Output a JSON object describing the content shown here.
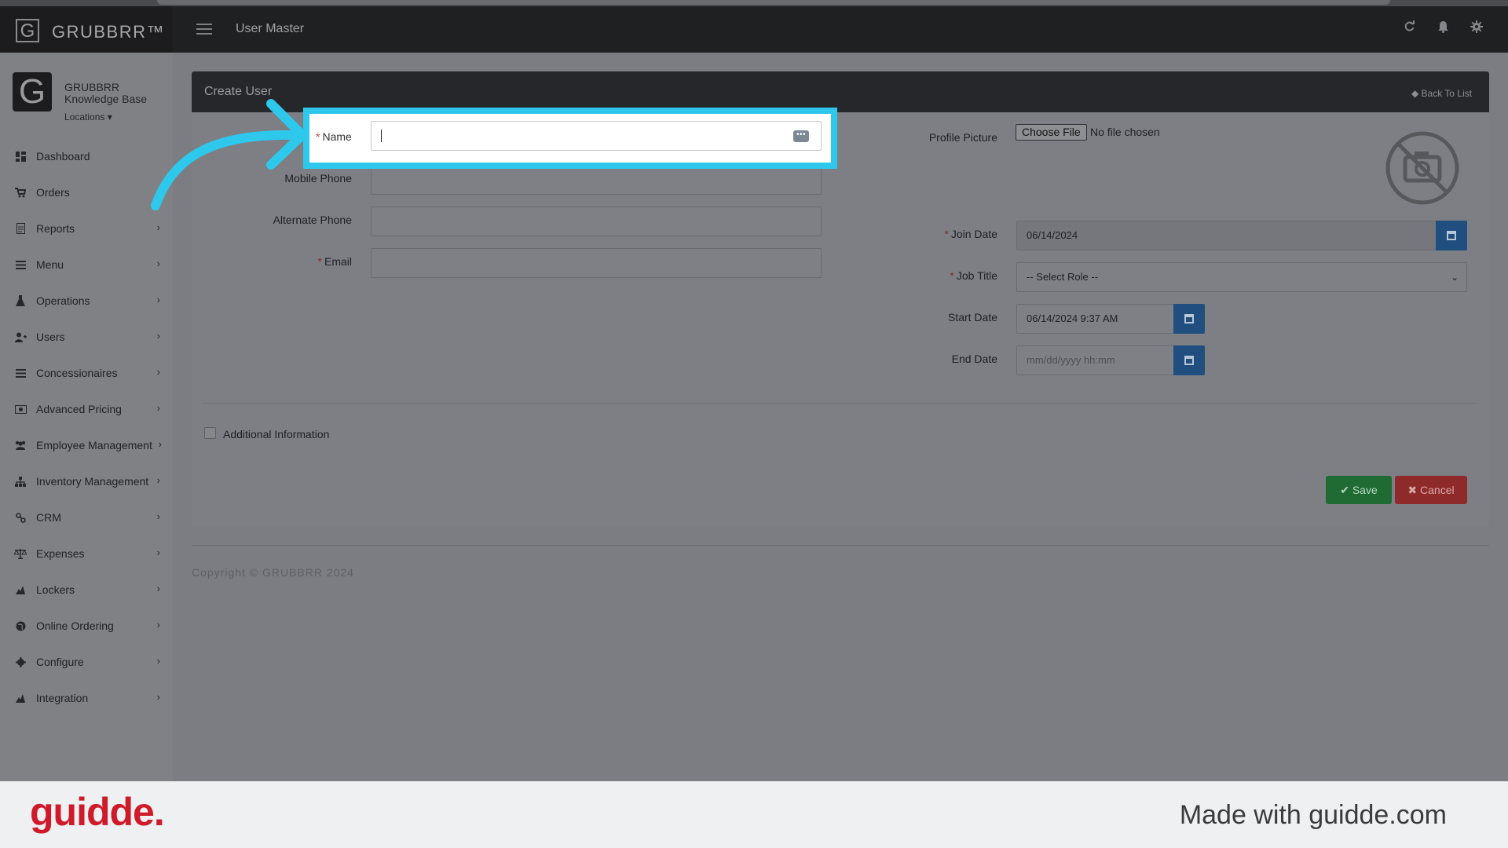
{
  "app": {
    "brand": "GRUBBRR™",
    "logo_letter": "G"
  },
  "header": {
    "title": "User Master",
    "icons": [
      "refresh-icon",
      "bell-icon",
      "gear-icon"
    ]
  },
  "profile": {
    "org_line1": "GRUBBRR",
    "org_line2": "Knowledge Base",
    "locations_label": "Locations"
  },
  "sidebar": {
    "items": [
      {
        "label": "Dashboard",
        "icon": "dashboard-icon",
        "chevron": false
      },
      {
        "label": "Orders",
        "icon": "cart-icon",
        "chevron": false
      },
      {
        "label": "Reports",
        "icon": "report-icon",
        "chevron": true
      },
      {
        "label": "Menu",
        "icon": "list-icon",
        "chevron": true
      },
      {
        "label": "Operations",
        "icon": "flask-icon",
        "chevron": true
      },
      {
        "label": "Users",
        "icon": "user-plus-icon",
        "chevron": true
      },
      {
        "label": "Concessionaires",
        "icon": "list-icon",
        "chevron": true
      },
      {
        "label": "Advanced Pricing",
        "icon": "money-icon",
        "chevron": true
      },
      {
        "label": "Employee Management",
        "icon": "users-icon",
        "chevron": true
      },
      {
        "label": "Inventory Management",
        "icon": "sitemap-icon",
        "chevron": true
      },
      {
        "label": "CRM",
        "icon": "link-icon",
        "chevron": true
      },
      {
        "label": "Expenses",
        "icon": "balance-icon",
        "chevron": true
      },
      {
        "label": "Lockers",
        "icon": "lock-icon",
        "chevron": true
      },
      {
        "label": "Online Ordering",
        "icon": "globe-icon",
        "chevron": true
      },
      {
        "label": "Configure",
        "icon": "cog-icon",
        "chevron": true
      },
      {
        "label": "Integration",
        "icon": "plug-icon",
        "chevron": true
      }
    ]
  },
  "form": {
    "title": "Create User",
    "back_link": "Back To List",
    "name_label": "Name",
    "name_value": "",
    "mobile_label": "Mobile Phone",
    "alternate_label": "Alternate Phone",
    "email_label": "Email",
    "profile_picture_label": "Profile Picture",
    "choose_file_label": "Choose File",
    "no_file_text": "No file chosen",
    "join_date_label": "Join Date",
    "join_date_value": "06/14/2024",
    "job_title_label": "Job Title",
    "job_title_value": "-- Select Role --",
    "start_date_label": "Start Date",
    "start_date_value": "06/14/2024 9:37 AM",
    "end_date_label": "End Date",
    "end_date_placeholder": "mm/dd/yyyy hh:mm",
    "additional_info_label": "Additional Information",
    "save_label": "Save",
    "cancel_label": "Cancel",
    "required_mark": "*"
  },
  "footer": {
    "copyright": "Copyright © GRUBBRR 2024"
  },
  "guidde": {
    "logo_text": "guidde.",
    "made_with": "Made with guidde.com"
  },
  "colors": {
    "highlight": "#2ec8ec",
    "save": "#28a745",
    "cancel": "#dc3545",
    "calendar_button": "#2a6ebb",
    "guidde_red": "#cf1a2a"
  }
}
